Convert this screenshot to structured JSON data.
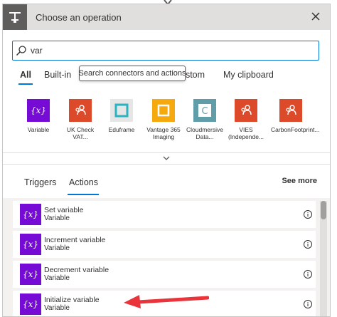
{
  "header": {
    "title": "Choose an operation"
  },
  "search": {
    "value": "var",
    "placeholder": ""
  },
  "tabs": [
    {
      "label": "All",
      "active": true
    },
    {
      "label": "Built-in",
      "active": false
    },
    {
      "label": "Custom",
      "visible_label": "ustom",
      "active": false
    },
    {
      "label": "My clipboard",
      "active": false
    }
  ],
  "tooltip": {
    "text": "Search connectors and actions"
  },
  "connectors": [
    {
      "label": "Variable",
      "icon": "variable-icon",
      "color": "#770bd6"
    },
    {
      "label": "UK Check VAT...",
      "icon": "connector-person-icon",
      "color": "#dc4a2a"
    },
    {
      "label": "Eduframe",
      "icon": "eduframe-icon",
      "color": "#e6e6e6"
    },
    {
      "label": "Vantage 365 Imaging",
      "icon": "vantage-icon",
      "color": "#f6a90c"
    },
    {
      "label": "Cloudmersive Data...",
      "icon": "cloudmersive-icon",
      "color": "#5f9ea8"
    },
    {
      "label": "VIES (Independe...",
      "icon": "connector-person-icon",
      "color": "#dc4a2a"
    },
    {
      "label": "CarbonFootprint...",
      "icon": "connector-person-icon",
      "color": "#dc4a2a"
    }
  ],
  "action_tabs": [
    {
      "label": "Triggers",
      "active": false
    },
    {
      "label": "Actions",
      "active": true
    }
  ],
  "see_more": "See more",
  "actions": [
    {
      "name": "Set variable",
      "connector": "Variable"
    },
    {
      "name": "Increment variable",
      "connector": "Variable"
    },
    {
      "name": "Decrement variable",
      "connector": "Variable"
    },
    {
      "name": "Initialize variable",
      "connector": "Variable"
    }
  ],
  "colors": {
    "accent": "#0078d4",
    "variable": "#770bd6",
    "arrow": "#e8343a"
  }
}
